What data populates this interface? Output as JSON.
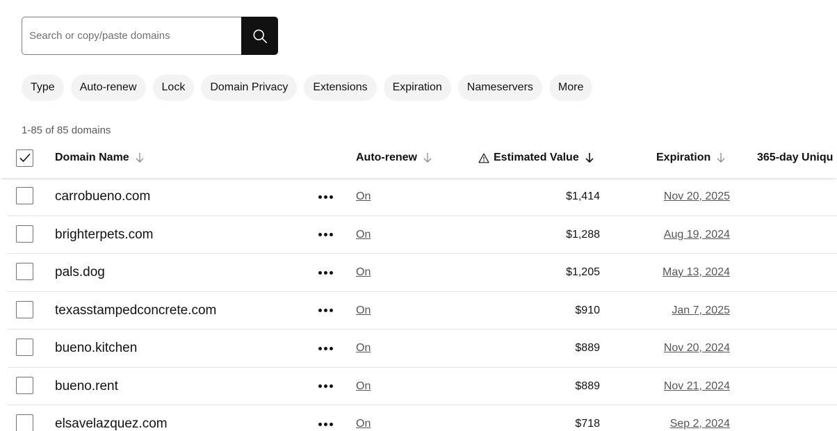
{
  "search": {
    "placeholder": "Search or copy/paste domains",
    "value": "",
    "button_icon": "search-icon"
  },
  "filters": [
    "Type",
    "Auto-renew",
    "Lock",
    "Domain Privacy",
    "Extensions",
    "Expiration",
    "Nameservers",
    "More"
  ],
  "count_label": "1-85 of 85 domains",
  "table": {
    "select_all_checked": true,
    "columns": {
      "name": "Domain Name",
      "auto_renew": "Auto-renew",
      "value": "Estimated Value",
      "expiration": "Expiration",
      "unique": "365-day Uniqu"
    },
    "rows": [
      {
        "domain": "carrobueno.com",
        "auto_renew": "On",
        "value": "$1,414",
        "expiration": "Nov 20, 2025"
      },
      {
        "domain": "brighterpets.com",
        "auto_renew": "On",
        "value": "$1,288",
        "expiration": "Aug 19, 2024"
      },
      {
        "domain": "pals.dog",
        "auto_renew": "On",
        "value": "$1,205",
        "expiration": "May 13, 2024"
      },
      {
        "domain": "texasstampedconcrete.com",
        "auto_renew": "On",
        "value": "$910",
        "expiration": "Jan 7, 2025"
      },
      {
        "domain": "bueno.kitchen",
        "auto_renew": "On",
        "value": "$889",
        "expiration": "Nov 20, 2024"
      },
      {
        "domain": "bueno.rent",
        "auto_renew": "On",
        "value": "$889",
        "expiration": "Nov 21, 2024"
      },
      {
        "domain": "elsavelazquez.com",
        "auto_renew": "On",
        "value": "$718",
        "expiration": "Sep 2, 2024"
      }
    ]
  }
}
